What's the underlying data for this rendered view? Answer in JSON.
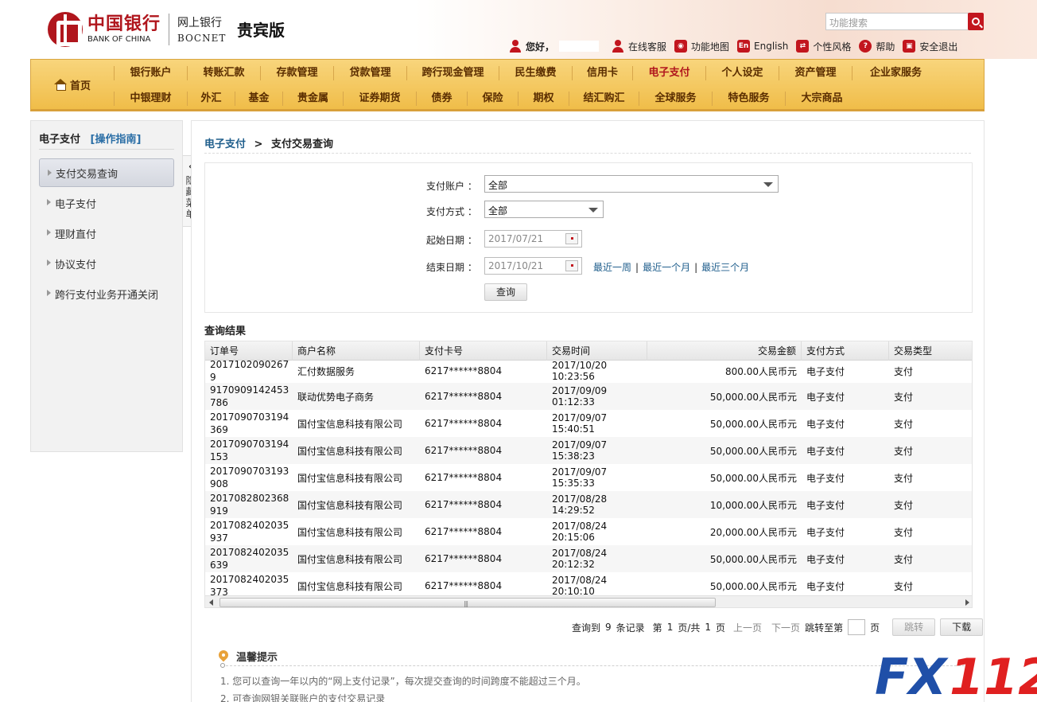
{
  "header": {
    "logo_cn": "中国银行",
    "logo_en": "BANK OF CHINA",
    "bank_cn": "网上银行",
    "bank_en": "BOCNET",
    "edition": "贵宾版",
    "search_placeholder": "功能搜索",
    "greeting": "您好，",
    "links": {
      "service": "在线客服",
      "sitemap": "功能地图",
      "english_badge": "En",
      "english": "English",
      "style": "个性风格",
      "help": "帮助",
      "logout": "安全退出"
    }
  },
  "nav": {
    "home": "首页",
    "row1": [
      "银行账户",
      "转账汇款",
      "存款管理",
      "贷款管理",
      "跨行现金管理",
      "民生缴费",
      "信用卡",
      "电子支付",
      "个人设定",
      "资产管理",
      "企业家服务"
    ],
    "row2": [
      "中银理财",
      "外汇",
      "基金",
      "贵金属",
      "证券期货",
      "债券",
      "保险",
      "期权",
      "结汇购汇",
      "全球服务",
      "特色服务",
      "大宗商品"
    ],
    "active": "电子支付"
  },
  "sidebar": {
    "title": "电子支付",
    "guide": "[操作指南]",
    "items": [
      "支付交易查询",
      "电子支付",
      "理财直付",
      "协议支付",
      "跨行支付业务开通关闭"
    ],
    "collapse_label": "隐藏菜单"
  },
  "breadcrumb": {
    "parent": "电子支付",
    "sep": ">",
    "current": "支付交易查询"
  },
  "query": {
    "account_label": "支付账户 ：",
    "account_value": "全部",
    "method_label": "支付方式 ：",
    "method_value": "全部",
    "start_label": "起始日期 ：",
    "start_value": "2017/07/21",
    "end_label": "结束日期 ：",
    "end_value": "2017/10/21",
    "quick_week": "最近一周",
    "quick_month": "最近一个月",
    "quick_3months": "最近三个月",
    "submit": "查询"
  },
  "results": {
    "title": "查询结果",
    "columns": [
      "订单号",
      "商户名称",
      "支付卡号",
      "交易时间",
      "交易金额",
      "支付方式",
      "交易类型"
    ],
    "rows": [
      [
        "20171020902679",
        "汇付数据服务",
        "6217******8804",
        "2017/10/20 10:23:56",
        "800.00人民币元",
        "电子支付",
        "支付"
      ],
      [
        "9170909142453786",
        "联动优势电子商务",
        "6217******8804",
        "2017/09/09 01:12:33",
        "50,000.00人民币元",
        "电子支付",
        "支付"
      ],
      [
        "2017090703194369",
        "国付宝信息科技有限公司",
        "6217******8804",
        "2017/09/07 15:40:51",
        "50,000.00人民币元",
        "电子支付",
        "支付"
      ],
      [
        "2017090703194153",
        "国付宝信息科技有限公司",
        "6217******8804",
        "2017/09/07 15:38:23",
        "50,000.00人民币元",
        "电子支付",
        "支付"
      ],
      [
        "2017090703193908",
        "国付宝信息科技有限公司",
        "6217******8804",
        "2017/09/07 15:35:33",
        "50,000.00人民币元",
        "电子支付",
        "支付"
      ],
      [
        "2017082802368919",
        "国付宝信息科技有限公司",
        "6217******8804",
        "2017/08/28 14:29:52",
        "10,000.00人民币元",
        "电子支付",
        "支付"
      ],
      [
        "2017082402035937",
        "国付宝信息科技有限公司",
        "6217******8804",
        "2017/08/24 20:15:06",
        "20,000.00人民币元",
        "电子支付",
        "支付"
      ],
      [
        "2017082402035639",
        "国付宝信息科技有限公司",
        "6217******8804",
        "2017/08/24 20:12:32",
        "50,000.00人民币元",
        "电子支付",
        "支付"
      ],
      [
        "2017082402035373",
        "国付宝信息科技有限公司",
        "6217******8804",
        "2017/08/24 20:10:10",
        "50,000.00人民币元",
        "电子支付",
        "支付"
      ]
    ]
  },
  "pager": {
    "found_prefix": "查询到",
    "count": "9",
    "found_suffix": "条记录",
    "page_prefix": "第",
    "page_current": "1",
    "page_mid": "页/共",
    "page_total": "1",
    "page_suffix": "页",
    "prev": "上一页",
    "next": "下一页",
    "jump_prefix": "跳转至第",
    "jump_suffix": "页",
    "jump_btn": "跳转",
    "download_btn": "下载"
  },
  "tips": {
    "title": "温馨提示",
    "items": [
      "1. 您可以查询一年以内的“网上支付记录”，每次提交查询的时间跨度不能超过三个月。",
      "2. 可查询网银关联账户的支付交易记录"
    ]
  },
  "watermark": "FX112",
  "colors": {
    "brand_red": "#b0161d",
    "nav_gold": "#f0bd49",
    "link_blue": "#1f5e8c",
    "watermark_blue": "#1f4fa8",
    "watermark_red": "#e02020"
  }
}
